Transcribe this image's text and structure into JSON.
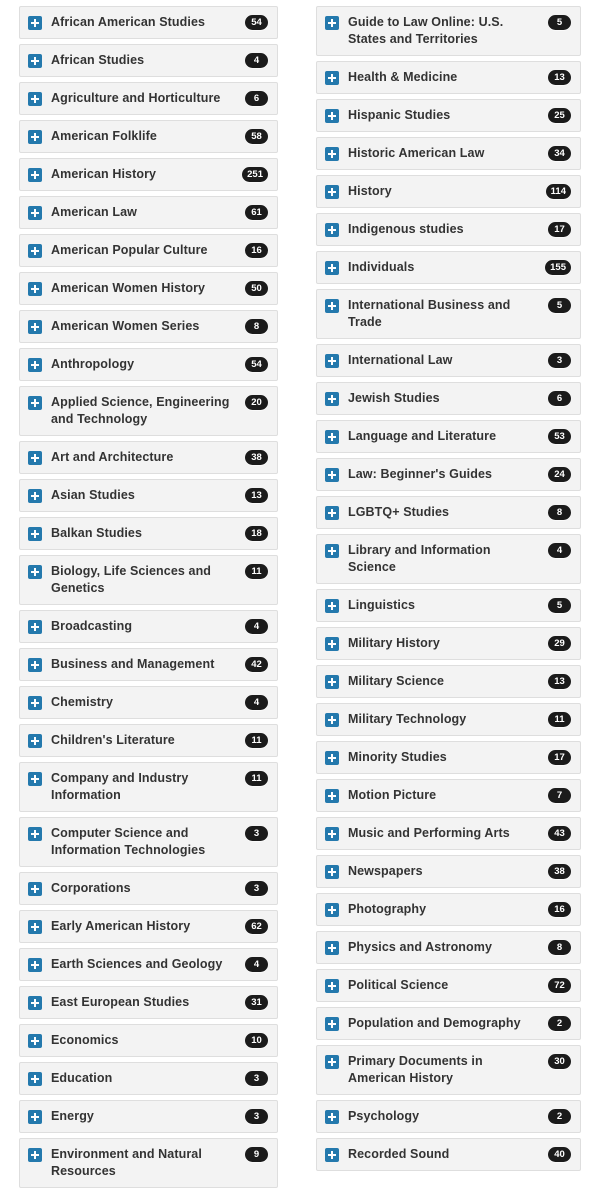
{
  "icon_names": {
    "expand": "plus-square-icon"
  },
  "colors": {
    "accent": "#2479ad",
    "row_bg": "#f3f3f3",
    "row_border": "#dedede",
    "badge_bg": "#1b1b1b",
    "text": "#333333"
  },
  "columns": [
    {
      "name": "left-column",
      "items": [
        {
          "label": "African American Studies",
          "count": "54"
        },
        {
          "label": "African Studies",
          "count": "4"
        },
        {
          "label": "Agriculture and Horticulture",
          "count": "6"
        },
        {
          "label": "American Folklife",
          "count": "58"
        },
        {
          "label": "American History",
          "count": "251"
        },
        {
          "label": "American Law",
          "count": "61"
        },
        {
          "label": "American Popular Culture",
          "count": "16"
        },
        {
          "label": "American Women History",
          "count": "50"
        },
        {
          "label": "American Women Series",
          "count": "8"
        },
        {
          "label": "Anthropology",
          "count": "54"
        },
        {
          "label": "Applied Science, Engineering and Technology",
          "count": "20"
        },
        {
          "label": "Art and Architecture",
          "count": "38"
        },
        {
          "label": "Asian Studies",
          "count": "13"
        },
        {
          "label": "Balkan Studies",
          "count": "18"
        },
        {
          "label": "Biology, Life Sciences and Genetics",
          "count": "11"
        },
        {
          "label": "Broadcasting",
          "count": "4"
        },
        {
          "label": "Business and Management",
          "count": "42"
        },
        {
          "label": "Chemistry",
          "count": "4"
        },
        {
          "label": "Children's Literature",
          "count": "11"
        },
        {
          "label": "Company and Industry Information",
          "count": "11"
        },
        {
          "label": "Computer Science and Information Technologies",
          "count": "3"
        },
        {
          "label": "Corporations",
          "count": "3"
        },
        {
          "label": "Early American History",
          "count": "62"
        },
        {
          "label": "Earth Sciences and Geology",
          "count": "4"
        },
        {
          "label": "East European Studies",
          "count": "31"
        },
        {
          "label": "Economics",
          "count": "10"
        },
        {
          "label": "Education",
          "count": "3"
        },
        {
          "label": "Energy",
          "count": "3"
        },
        {
          "label": "Environment and Natural Resources",
          "count": "9"
        }
      ]
    },
    {
      "name": "right-column",
      "items": [
        {
          "label": "Guide to Law Online: U.S. States and Territories",
          "count": "5"
        },
        {
          "label": "Health & Medicine",
          "count": "13"
        },
        {
          "label": "Hispanic Studies",
          "count": "25"
        },
        {
          "label": "Historic American Law",
          "count": "34"
        },
        {
          "label": "History",
          "count": "114"
        },
        {
          "label": "Indigenous studies",
          "count": "17"
        },
        {
          "label": "Individuals",
          "count": "155"
        },
        {
          "label": "International Business and Trade",
          "count": "5"
        },
        {
          "label": "International Law",
          "count": "3"
        },
        {
          "label": "Jewish Studies",
          "count": "6"
        },
        {
          "label": "Language and Literature",
          "count": "53"
        },
        {
          "label": "Law: Beginner's Guides",
          "count": "24"
        },
        {
          "label": "LGBTQ+ Studies",
          "count": "8"
        },
        {
          "label": "Library and Information Science",
          "count": "4"
        },
        {
          "label": "Linguistics",
          "count": "5"
        },
        {
          "label": "Military History",
          "count": "29"
        },
        {
          "label": "Military Science",
          "count": "13"
        },
        {
          "label": "Military Technology",
          "count": "11"
        },
        {
          "label": "Minority Studies",
          "count": "17"
        },
        {
          "label": "Motion Picture",
          "count": "7"
        },
        {
          "label": "Music and Performing Arts",
          "count": "43"
        },
        {
          "label": "Newspapers",
          "count": "38"
        },
        {
          "label": "Photography",
          "count": "16"
        },
        {
          "label": "Physics and Astronomy",
          "count": "8"
        },
        {
          "label": "Political Science",
          "count": "72"
        },
        {
          "label": "Population and Demography",
          "count": "2"
        },
        {
          "label": "Primary Documents in American History",
          "count": "30"
        },
        {
          "label": "Psychology",
          "count": "2"
        },
        {
          "label": "Recorded Sound",
          "count": "40"
        }
      ]
    }
  ]
}
